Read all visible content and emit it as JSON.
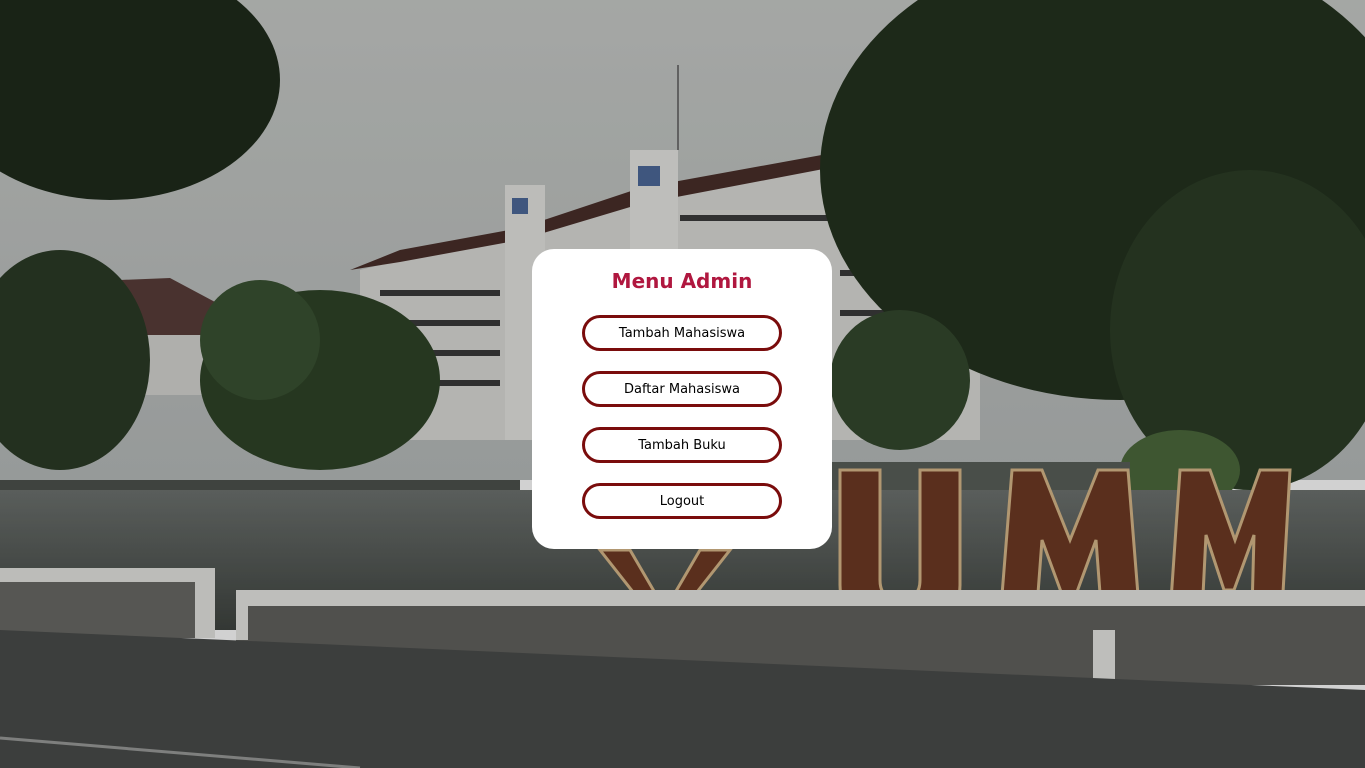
{
  "background": {
    "description_icon": "campus-photo",
    "sign_text": "UMM"
  },
  "admin_menu": {
    "title": "Menu Admin",
    "buttons": [
      {
        "label": "Tambah Mahasiswa"
      },
      {
        "label": "Daftar Mahasiswa"
      },
      {
        "label": "Tambah Buku"
      },
      {
        "label": "Logout"
      }
    ]
  },
  "colors": {
    "title": "#b0173f",
    "button_border": "#7a0c0c",
    "card_bg": "#ffffff"
  }
}
